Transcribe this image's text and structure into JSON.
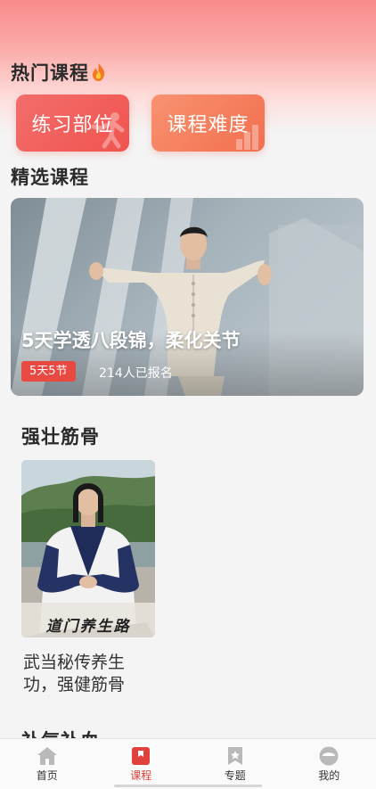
{
  "hot_section": {
    "title": "热门课程",
    "categories": [
      {
        "label": "练习部位"
      },
      {
        "label": "课程难度"
      }
    ]
  },
  "featured_section": {
    "title": "精选课程",
    "card": {
      "title": "5天学透八段锦，柔化关节",
      "badge": "5天5节",
      "enrolled": "214人已报名"
    }
  },
  "strengthen_section": {
    "title": "强壮筋骨",
    "course": {
      "description": "武当秘传养生功，强健筋骨",
      "thumb_caption": "道门养生路"
    }
  },
  "next_section": {
    "title": "补气补血"
  },
  "tabbar": {
    "tabs": [
      {
        "label": "首页",
        "icon": "home-icon"
      },
      {
        "label": "课程",
        "icon": "course-icon"
      },
      {
        "label": "专题",
        "icon": "topic-icon"
      },
      {
        "label": "我的",
        "icon": "profile-icon"
      }
    ],
    "active_index": 1
  },
  "colors": {
    "accent": "#e0413b",
    "badge": "#e84a42",
    "category_left": "#f0544f",
    "category_right": "#f26f4f",
    "tab_icon": "#b9b9b9"
  }
}
